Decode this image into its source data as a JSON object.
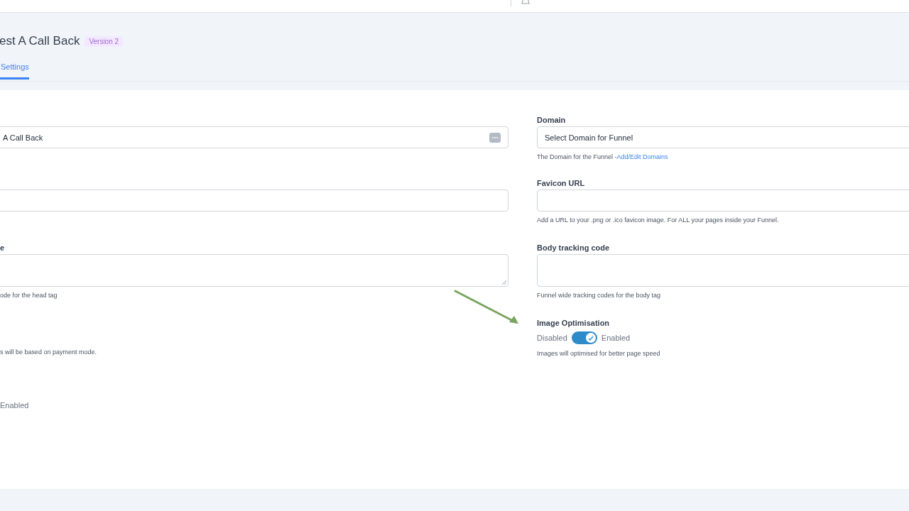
{
  "header": {
    "title": "est A Call Back",
    "badge": "Version 2"
  },
  "tabs": [
    {
      "label": "Settings",
      "selected": true
    }
  ],
  "left_fields": [
    {
      "kind": "input",
      "value": "A Call Back",
      "has_action": true
    },
    {
      "kind": "input",
      "has_action": false
    },
    {
      "kind": "textarea",
      "label": "e",
      "help": "ode for the head tag"
    },
    {
      "kind": "none",
      "help": "s will be based on payment mode."
    },
    {
      "kind": "text",
      "text": "Enabled"
    }
  ],
  "right_fields": [
    {
      "kind": "select",
      "label": "Domain",
      "value": "Select Domain for Funnel",
      "help": "The Domain for the Funnel -",
      "link": "Add/Edit Domains"
    },
    {
      "kind": "input",
      "label": "Favicon URL",
      "help": "Add a URL to your .png or .ico favicon image. For ALL your pages inside your Funnel."
    },
    {
      "kind": "textarea",
      "label": "Body tracking code",
      "help": "Funnel wide tracking codes for the body tag"
    },
    {
      "kind": "toggle",
      "label": "Image Optimisation",
      "off_label": "Disabled",
      "on_label": "Enabled",
      "on": true,
      "help": "Images will optimised for better page speed"
    }
  ]
}
